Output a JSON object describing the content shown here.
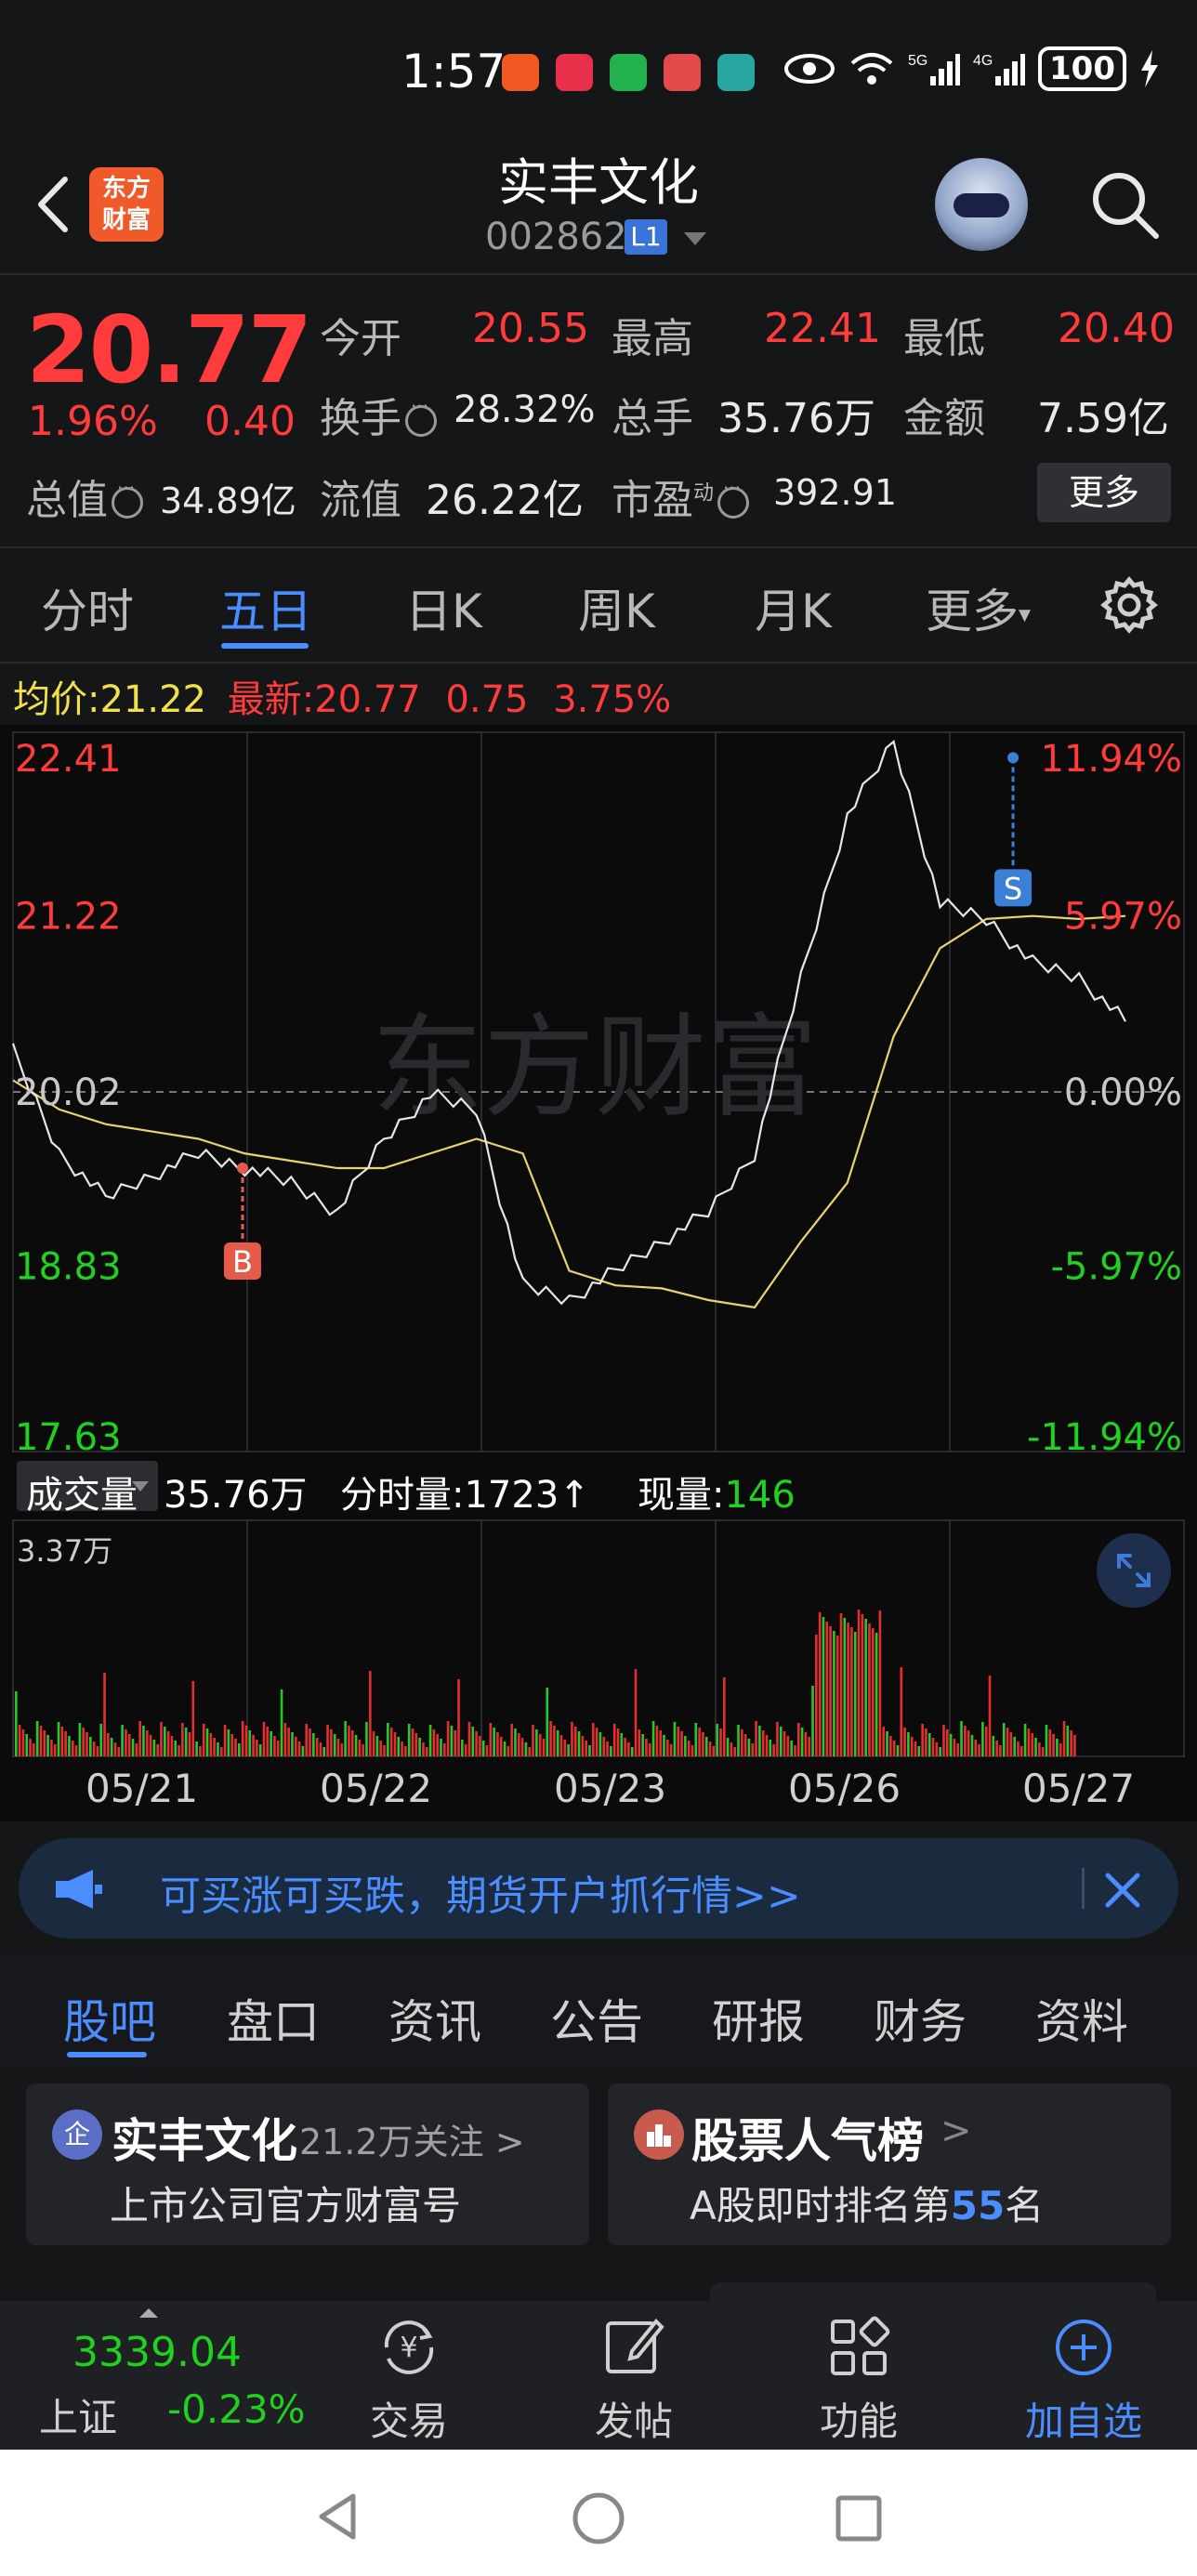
{
  "status_bar": {
    "time": "1:57",
    "battery": "100"
  },
  "header": {
    "title": "实丰文化",
    "code": "002862",
    "level_badge": "L1",
    "logo_line1": "东方",
    "logo_line2": "财富"
  },
  "quote": {
    "price": "20.77",
    "pct": "1.96%",
    "change": "0.40",
    "open_label": "今开",
    "open": "20.55",
    "high_label": "最高",
    "high": "22.41",
    "low_label": "最低",
    "low": "20.40",
    "turnover_label": "换手",
    "turnover": "28.32%",
    "volume_label": "总手",
    "volume": "35.76万",
    "amount_label": "金额",
    "amount": "7.59亿",
    "mktcap_label": "总值",
    "mktcap": "34.89亿",
    "float_label": "流值",
    "float": "26.22亿",
    "pe_label": "市盈",
    "pe_sup": "动",
    "pe": "392.91",
    "more": "更多"
  },
  "kline_tabs": {
    "items": [
      "分时",
      "五日",
      "日K",
      "周K",
      "月K",
      "更多"
    ],
    "active": "五日"
  },
  "avg_row": {
    "avg_label": "均价:",
    "avg": "21.22",
    "latest_label": "最新:",
    "latest": "20.77",
    "chg": "0.75",
    "pct": "3.75%"
  },
  "chart_data": {
    "type": "line",
    "title": "",
    "x": [
      "05/21",
      "05/22",
      "05/23",
      "05/26",
      "05/27"
    ],
    "y_left_ticks": [
      "22.41",
      "21.22",
      "20.02",
      "18.83",
      "17.63"
    ],
    "y_right_ticks": [
      "11.94%",
      "5.97%",
      "0.00%",
      "-5.97%",
      "-11.94%"
    ],
    "ylim": [
      17.63,
      22.41
    ],
    "prev_close": 20.02,
    "series": [
      {
        "values": [
          20.3,
          19.6,
          19.3,
          19.45,
          19.6,
          19.5,
          19.4,
          19.2,
          19.7,
          20.0,
          19.9,
          18.7,
          18.6,
          18.8,
          19.0,
          19.2,
          19.6,
          20.8,
          21.9,
          22.41,
          21.3,
          21.2,
          20.9,
          20.8,
          20.5
        ]
      },
      {
        "values": [
          20.1,
          19.9,
          19.8,
          19.75,
          19.7,
          19.6,
          19.55,
          19.5,
          19.5,
          19.6,
          19.7,
          19.6,
          18.8,
          18.7,
          18.68,
          18.6,
          18.55,
          19.0,
          19.4,
          20.4,
          21.0,
          21.2,
          21.22,
          21.2,
          21.22
        ]
      }
    ],
    "markers": [
      {
        "label": "B",
        "price": 19.5,
        "day": "05/21"
      },
      {
        "label": "S",
        "price": 22.3,
        "day": "05/27"
      }
    ],
    "watermark": "东方财富"
  },
  "volume": {
    "label": "成交量",
    "total": "35.76万",
    "tick_label": "分时量:",
    "tick": "1723",
    "tick_arrow": "↑",
    "now_label": "现量:",
    "now": "146",
    "max": "3.37万"
  },
  "banner": {
    "text": "可买涨可买跌，期货开户抓行情>>"
  },
  "section_tabs": {
    "items": [
      "股吧",
      "盘口",
      "资讯",
      "公告",
      "研报",
      "财务",
      "资料"
    ],
    "active": "股吧"
  },
  "cards": [
    {
      "icon_text": "企",
      "title": "实丰文化",
      "follow": "21.2万关注",
      "arrow": ">",
      "subtitle": "上市公司官方财富号"
    },
    {
      "title": "股票人气榜",
      "arrow": ">",
      "sub_prefix": "A股即时排名第",
      "rank": "55",
      "sub_suffix": "名"
    }
  ],
  "bottom_nav": {
    "index_value": "3339.04",
    "index_name": "上证",
    "index_change": "-0.23%",
    "items": [
      "交易",
      "发帖",
      "功能",
      "加自选"
    ],
    "active": "加自选"
  }
}
